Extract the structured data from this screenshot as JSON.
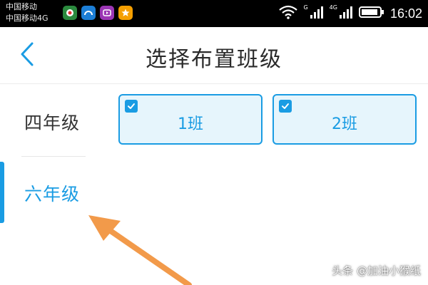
{
  "status_bar": {
    "carrier_1": "中国移动",
    "carrier_2": "中国移动4G",
    "signal_1_label": "G",
    "signal_2_label": "4G",
    "time": "16:02",
    "app_icons": [
      "weibo-app-icon",
      "browser-app-icon",
      "video-app-icon",
      "star-app-icon"
    ]
  },
  "header": {
    "title": "选择布置班级",
    "back_icon": "chevron-left-icon"
  },
  "sidebar": {
    "grades": [
      {
        "label": "四年级",
        "selected": false
      },
      {
        "label": "六年级",
        "selected": true
      }
    ]
  },
  "classes": [
    {
      "label": "1班",
      "checked": true
    },
    {
      "label": "2班",
      "checked": true
    }
  ],
  "watermark": "头条 @加油小猴纸",
  "colors": {
    "accent": "#1a9ce3",
    "chip_bg": "#e6f5fc",
    "arrow": "#f29a4a",
    "status_bar": "#000000"
  }
}
